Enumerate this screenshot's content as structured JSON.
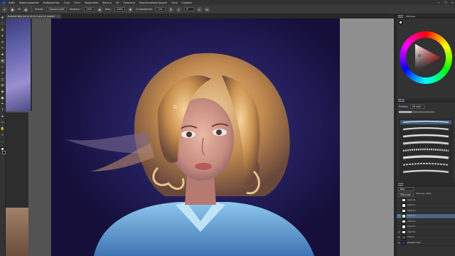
{
  "menu": {
    "logo": "Ps",
    "items": [
      "Файл",
      "Редактирование",
      "Изображение",
      "Слои",
      "Текст",
      "Выделение",
      "Фильтр",
      "3D",
      "Просмотр",
      "Подключаемые модули",
      "Окно",
      "Справка"
    ],
    "win_controls": [
      "—",
      "❐",
      "✕"
    ]
  },
  "options": {
    "brush_size": "60",
    "mode_label": "Режим:",
    "mode_value": "Нормальный",
    "opacity_label": "Непрозр.:",
    "opacity_value": "100%",
    "flow_label": "Наж.:",
    "flow_value": "100%",
    "smoothing_label": "Сглаживание:",
    "smoothing_value": "10%",
    "angle_value": "0°"
  },
  "document_tab": {
    "title": "Elizabeth Beth.psd @ 33.3% (Слой 13, RGB/8)*",
    "close": "×"
  },
  "tools": [
    {
      "name": "move-icon",
      "glyph": "✥"
    },
    {
      "name": "marquee-icon",
      "glyph": "⬚"
    },
    {
      "name": "lasso-icon",
      "glyph": "ϕ"
    },
    {
      "name": "quick-select-icon",
      "glyph": "✦"
    },
    {
      "name": "crop-icon",
      "glyph": "⌗"
    },
    {
      "name": "eyedropper-icon",
      "glyph": "✎"
    },
    {
      "name": "healing-icon",
      "glyph": "✚"
    },
    {
      "name": "brush-icon",
      "glyph": "✐"
    },
    {
      "name": "stamp-icon",
      "glyph": "⊥"
    },
    {
      "name": "history-brush-icon",
      "glyph": "↺"
    },
    {
      "name": "eraser-icon",
      "glyph": "◫"
    },
    {
      "name": "gradient-icon",
      "glyph": "▤"
    },
    {
      "name": "blur-icon",
      "glyph": "◆"
    },
    {
      "name": "dodge-icon",
      "glyph": "●"
    },
    {
      "name": "pen-icon",
      "glyph": "✒"
    },
    {
      "name": "type-icon",
      "glyph": "T"
    },
    {
      "name": "path-select-icon",
      "glyph": "➤"
    },
    {
      "name": "shape-icon",
      "glyph": "▭"
    },
    {
      "name": "hand-icon",
      "glyph": "✋"
    },
    {
      "name": "zoom-icon",
      "glyph": "⌕"
    },
    {
      "name": "more-tools-icon",
      "glyph": "…"
    }
  ],
  "colors": {
    "foreground": "#fbe8d2",
    "background": "#101010",
    "accent": "#5da1ff"
  },
  "panels": {
    "color_tabs": [
      "Цвет",
      "Образцы"
    ],
    "brush_tabs": [
      "Кисти"
    ],
    "brush_size_label": "Размер:",
    "brush_size_value": "60 пикс.",
    "layers_tabs": [
      "Слои"
    ],
    "layers_kind_label": "Вид",
    "layers_blend_label": "Обычные",
    "layers_opacity_label": "Непрозр.: 100%",
    "layers": [
      {
        "name": "Слой 16",
        "visible": false
      },
      {
        "name": "Слой 15",
        "visible": false
      },
      {
        "name": "Слой 14",
        "visible": false
      },
      {
        "name": "Слой 13",
        "visible": true
      },
      {
        "name": "Слой 12",
        "visible": false
      },
      {
        "name": "Слой 11",
        "visible": false
      },
      {
        "name": "Слой 10",
        "visible": true
      },
      {
        "name": "Слой 9",
        "visible": true
      },
      {
        "name": "Elizabeth Beth",
        "visible": true
      }
    ]
  }
}
